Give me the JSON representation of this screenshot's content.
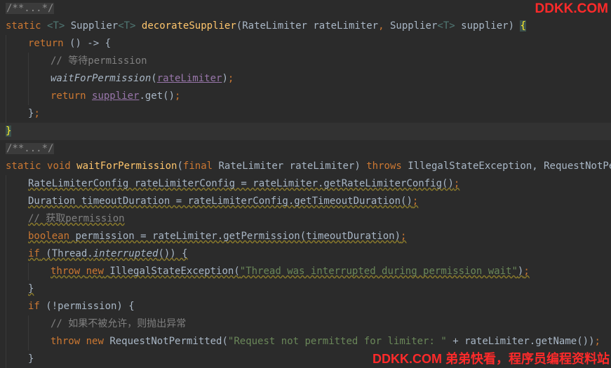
{
  "watermark": {
    "top": "DDKK.COM",
    "bottom": "DDKK.COM 弟弟快看，程序员编程资料站"
  },
  "code": {
    "l1": {
      "fold": "/**...*/"
    },
    "l2": {
      "static": "static",
      "t1": "<T>",
      "supplier_type": "Supplier",
      "t2": "<T>",
      "method": "decorateSupplier",
      "open": "(",
      "rl_type": "RateLimiter",
      "rl_name": "rateLimiter",
      "comma": ",",
      "sup_type": "Supplier",
      "t3": "<T>",
      "sup_name": "supplier",
      "close": ")",
      "brace": "{"
    },
    "l3": {
      "ret": "return",
      "lambda": "() -> {"
    },
    "l4": {
      "comment": "// 等待permission"
    },
    "l5": {
      "call": "waitForPermission",
      "open": "(",
      "arg": "rateLimiter",
      "close": ")",
      "semi": ";"
    },
    "l6": {
      "ret": "return",
      "supplier": "supplier",
      "rest": ".get()",
      "semi": ";"
    },
    "l7": {
      "close": "}",
      "semi": ";"
    },
    "l8": {
      "close": "}"
    },
    "l9": {
      "fold": "/**...*/"
    },
    "l10": {
      "static": "static",
      "void": "void",
      "method": "waitForPermission",
      "open": "(",
      "final": "final",
      "params": "RateLimiter rateLimiter)",
      "throws": "throws",
      "exceptions": "IllegalStateException, RequestNotPermitted {"
    },
    "l11": {
      "text": "RateLimiterConfig rateLimiterConfig = rateLimiter.getRateLimiterConfig()",
      "semi": ";"
    },
    "l12": {
      "text": "Duration timeoutDuration = rateLimiterConfig.getTimeoutDuration()",
      "semi": ";"
    },
    "l13": {
      "comment": "// 获取permission"
    },
    "l14": {
      "kw": "boolean",
      "text": " permission = rateLimiter.getPermission(timeoutDuration)",
      "semi": ";"
    },
    "l15": {
      "kw": "if",
      "pre": " (Thread.",
      "call": "interrupted",
      "post": "()) {"
    },
    "l16": {
      "throw": "throw",
      "new": "new",
      "cls": "IllegalStateException(",
      "str": "\"Thread was interrupted during permission wait\"",
      "close": ")",
      "semi": ";"
    },
    "l17": {
      "close": "}"
    },
    "l18": {
      "kw": "if",
      "text": " (!permission) {"
    },
    "l19": {
      "comment": "// 如果不被允许，则抛出异常"
    },
    "l20": {
      "throw": "throw",
      "new": "new",
      "cls": "RequestNotPermitted(",
      "str": "\"Request not permitted for limiter: \"",
      "rest": " + rateLimiter.getName())",
      "semi": ";"
    },
    "l21": {
      "close": "}"
    }
  },
  "colors": {
    "background": "#2b2b2b",
    "keyword": "#cc7832",
    "method": "#ffc66d",
    "comment": "#808080",
    "string": "#6a8759",
    "text": "#a9b7c6",
    "watermark": "#ff2a2a"
  }
}
